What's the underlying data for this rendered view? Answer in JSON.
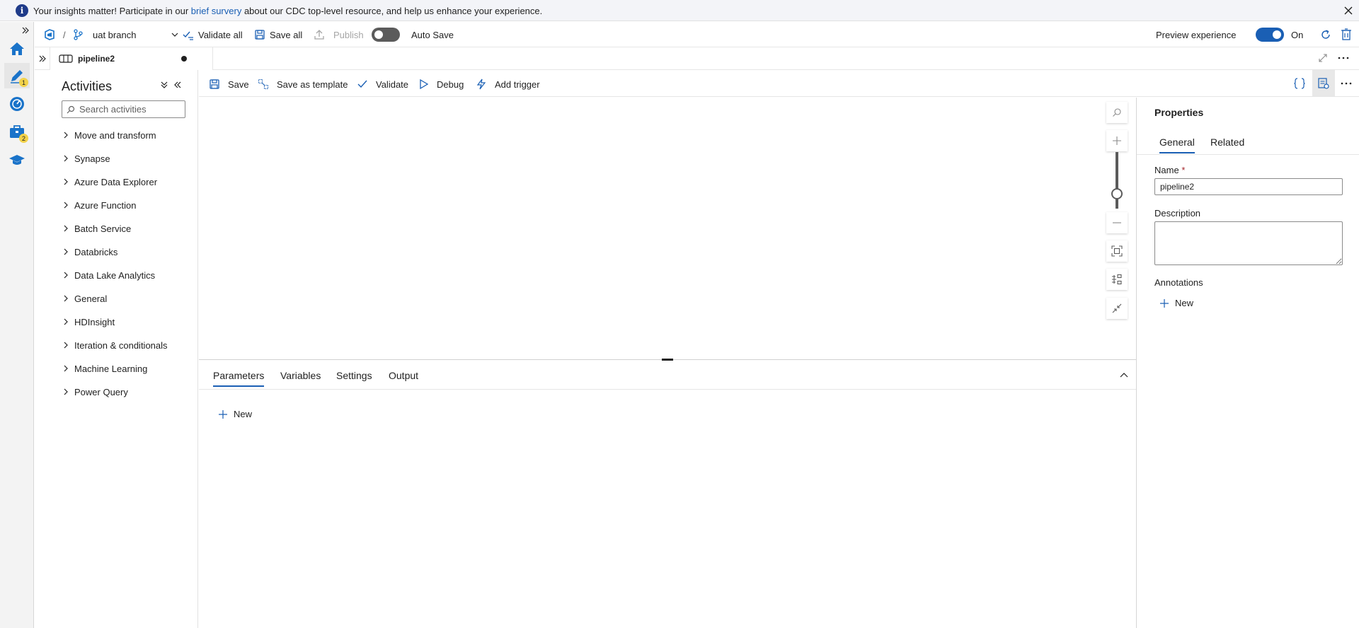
{
  "banner": {
    "message_before": "Your insights matter! Participate in our ",
    "link_text": "brief survery",
    "message_after": " about our CDC top-level resource, and help us enhance your experience."
  },
  "rail": {
    "author_badge": "1",
    "manage_badge": "2"
  },
  "toolbar": {
    "separator": "/",
    "branch": "uat branch",
    "validate_all": "Validate all",
    "save_all": "Save all",
    "publish": "Publish",
    "auto_save": "Auto Save",
    "preview_experience": "Preview experience",
    "preview_state": "On"
  },
  "pipeline_tab": {
    "name": "pipeline2"
  },
  "activities": {
    "title": "Activities",
    "search_placeholder": "Search activities",
    "categories": [
      "Move and transform",
      "Synapse",
      "Azure Data Explorer",
      "Azure Function",
      "Batch Service",
      "Databricks",
      "Data Lake Analytics",
      "General",
      "HDInsight",
      "Iteration & conditionals",
      "Machine Learning",
      "Power Query"
    ]
  },
  "canvas_toolbar": {
    "save": "Save",
    "save_as_template": "Save as template",
    "validate": "Validate",
    "debug": "Debug",
    "add_trigger": "Add trigger"
  },
  "bottom_panel": {
    "tabs": [
      "Parameters",
      "Variables",
      "Settings",
      "Output"
    ],
    "new_label": "New"
  },
  "properties": {
    "title": "Properties",
    "tabs": [
      "General",
      "Related"
    ],
    "name_label": "Name",
    "required_mark": "*",
    "name_value": "pipeline2",
    "description_label": "Description",
    "description_value": "",
    "annotations_label": "Annotations",
    "new_label": "New"
  },
  "colors": {
    "accent": "#1a5fb4",
    "toggle_off": "#5b5b5b",
    "toggle_on": "#1a5fb4",
    "badge": "#f2d24a"
  }
}
